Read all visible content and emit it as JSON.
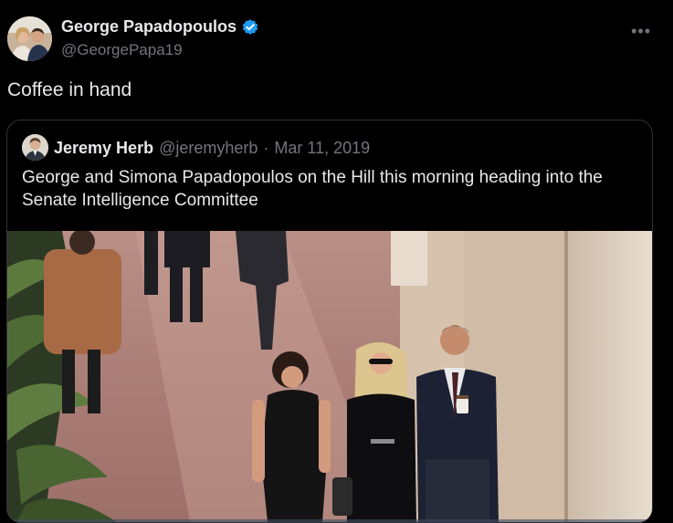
{
  "tweet": {
    "author_name": "George Papadopoulos",
    "author_handle": "@GeorgePapa19",
    "text": "Coffee in hand",
    "more_icon": "more-horizontal-icon",
    "verified_color": "#1d9bf0"
  },
  "quote": {
    "author_name": "Jeremy Herb",
    "author_handle": "@jeremyherb",
    "separator": "·",
    "date": "Mar 11, 2019",
    "text": "George and Simona Papadopoulos on the Hill this morning heading into the Senate Intelligence Committee"
  },
  "colors": {
    "background": "#000000",
    "text_primary": "#e7e9ea",
    "text_secondary": "#71767b",
    "border": "#2f3336"
  }
}
